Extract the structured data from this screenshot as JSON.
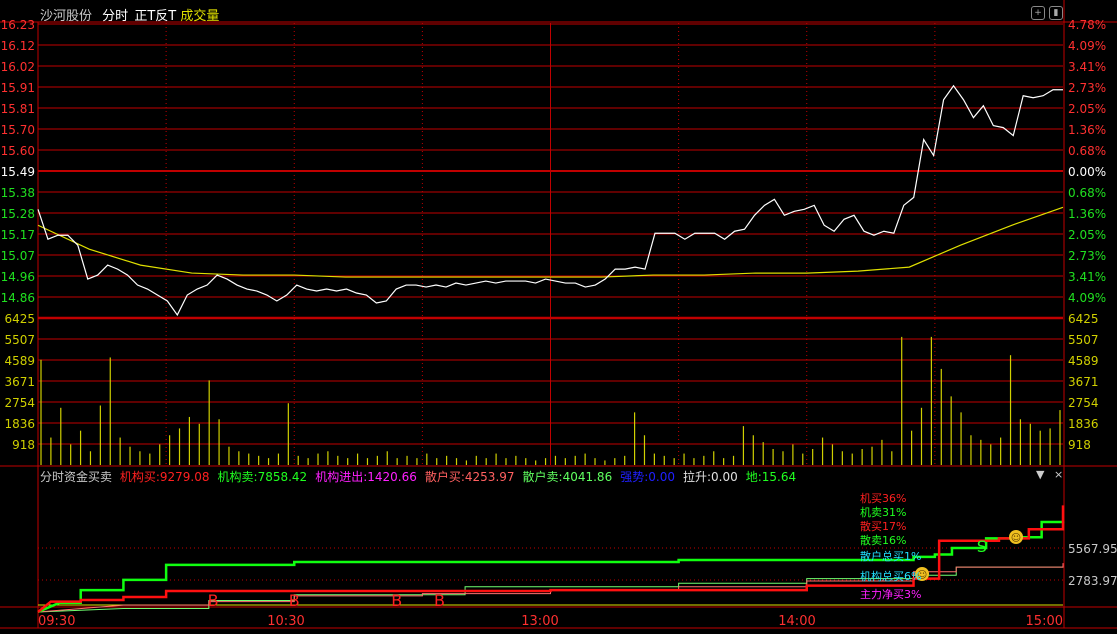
{
  "header": {
    "stock_name": "沙河股份",
    "mode": "分时",
    "strategy": "正T反T",
    "volume_label": "成交量"
  },
  "indicator": {
    "title": "分时资金买卖",
    "items": [
      {
        "label": "机构买:",
        "value": "9279.08",
        "color": "#ff2020"
      },
      {
        "label": "机构卖:",
        "value": "7858.42",
        "color": "#20ff20"
      },
      {
        "label": "机构进出:",
        "value": "1420.66",
        "color": "#ff20ff"
      },
      {
        "label": "散户买:",
        "value": "4253.97",
        "color": "#ff6060"
      },
      {
        "label": "散户卖:",
        "value": "4041.86",
        "color": "#60ff60"
      },
      {
        "label": "强势:",
        "value": "0.00",
        "color": "#2020ff"
      },
      {
        "label": "拉升:",
        "value": "0.00",
        "color": "#e0e0e0"
      },
      {
        "label": "地:",
        "value": "15.64",
        "color": "#20ff20"
      }
    ],
    "legend": [
      {
        "text": "机买36%",
        "color": "#ff2020"
      },
      {
        "text": "机卖31%",
        "color": "#20ff20"
      },
      {
        "text": "散买17%",
        "color": "#ff2020"
      },
      {
        "text": "散卖16%",
        "color": "#20ff20"
      },
      {
        "text": "散户总买1%",
        "color": "#20e0ff"
      },
      {
        "text": "机构总买6%",
        "color": "#20e0ff"
      },
      {
        "text": "主力净买3%",
        "color": "#ff20ff"
      }
    ],
    "axis_ticks": [
      "5567.95",
      "2783.97"
    ],
    "markers": [
      {
        "type": "B",
        "minute": 41
      },
      {
        "type": "B",
        "minute": 60
      },
      {
        "type": "B",
        "minute": 84
      },
      {
        "type": "B",
        "minute": 94
      },
      {
        "type": "S",
        "minute": 221
      },
      {
        "type": "smiley",
        "minute": 207
      },
      {
        "type": "smiley",
        "minute": 229
      }
    ],
    "controls": {
      "dropdown": "▼",
      "close": "×"
    }
  },
  "chart_data": {
    "type": "line",
    "title": "沙河股份 分时",
    "prev_close": 15.49,
    "price_ticks": [
      "16.23",
      "16.12",
      "16.02",
      "15.91",
      "15.81",
      "15.70",
      "15.60",
      "15.49",
      "15.38",
      "15.28",
      "15.17",
      "15.07",
      "14.96",
      "14.86"
    ],
    "pct_ticks": [
      "4.78%",
      "4.09%",
      "3.41%",
      "2.73%",
      "2.05%",
      "1.36%",
      "0.68%",
      "0.00%",
      "0.68%",
      "1.36%",
      "2.05%",
      "2.73%",
      "3.41%",
      "4.09%"
    ],
    "volume_ticks": [
      "6425",
      "5507",
      "4589",
      "3671",
      "2754",
      "1836",
      "918"
    ],
    "time_labels": [
      "09:30",
      "10:30",
      "13:00",
      "14:00",
      "15:00"
    ],
    "ylim": [
      14.86,
      16.23
    ],
    "volume_max": 6425,
    "price": [
      15.3,
      15.15,
      15.17,
      15.17,
      15.12,
      14.95,
      14.97,
      15.02,
      15.0,
      14.97,
      14.92,
      14.9,
      14.87,
      14.84,
      14.77,
      14.87,
      14.9,
      14.92,
      14.97,
      14.95,
      14.92,
      14.9,
      14.89,
      14.87,
      14.84,
      14.87,
      14.92,
      14.9,
      14.89,
      14.9,
      14.89,
      14.9,
      14.88,
      14.87,
      14.83,
      14.84,
      14.9,
      14.92,
      14.92,
      14.91,
      14.92,
      14.91,
      14.93,
      14.92,
      14.93,
      14.94,
      14.93,
      14.94,
      14.94,
      14.94,
      14.93,
      14.95,
      14.94,
      14.93,
      14.93,
      14.91,
      14.92,
      14.95,
      15.0,
      15.0,
      15.01,
      15.0,
      15.18,
      15.18,
      15.18,
      15.15,
      15.18,
      15.18,
      15.18,
      15.15,
      15.19,
      15.2,
      15.27,
      15.32,
      15.35,
      15.27,
      15.29,
      15.3,
      15.32,
      15.22,
      15.19,
      15.25,
      15.27,
      15.19,
      15.17,
      15.19,
      15.18,
      15.32,
      15.36,
      15.65,
      15.57,
      15.85,
      15.92,
      15.85,
      15.76,
      15.82,
      15.72,
      15.71,
      15.67,
      15.87,
      15.86,
      15.87,
      15.9,
      15.9
    ],
    "avg_price": [
      15.22,
      15.1,
      15.02,
      14.98,
      14.97,
      14.97,
      14.96,
      14.96,
      14.96,
      14.96,
      14.96,
      14.96,
      14.97,
      14.97,
      14.98,
      14.98,
      14.99,
      15.01,
      15.12,
      15.22,
      15.31
    ],
    "volume": [
      4600,
      1200,
      2500,
      900,
      1500,
      600,
      2600,
      4700,
      1200,
      800,
      600,
      500,
      900,
      1300,
      1600,
      2100,
      1800,
      3700,
      2000,
      800,
      600,
      500,
      400,
      300,
      500,
      2700,
      400,
      300,
      500,
      600,
      400,
      300,
      500,
      300,
      400,
      600,
      300,
      400,
      300,
      500,
      300,
      400,
      300,
      200,
      400,
      300,
      500,
      300,
      400,
      300,
      200,
      300,
      400,
      300,
      400,
      500,
      300,
      200,
      300,
      400,
      2300,
      1300,
      500,
      400,
      300,
      500,
      300,
      400,
      600,
      300,
      400,
      1700,
      1300,
      1000,
      700,
      600,
      900,
      500,
      700,
      1200,
      900,
      600,
      500,
      700,
      800,
      1100,
      600,
      5600,
      1500,
      2500,
      5600,
      4200,
      3000,
      2300,
      1300,
      1100,
      900,
      1200,
      4800,
      2000,
      1800,
      1500,
      1600,
      2400
    ],
    "series": [
      {
        "name": "机构买",
        "color": "#ff1010",
        "width": 2.5,
        "points": [
          [
            0,
            0
          ],
          [
            3,
            900
          ],
          [
            10,
            1040
          ],
          [
            20,
            1300
          ],
          [
            30,
            1830
          ],
          [
            60,
            1830
          ],
          [
            120,
            1900
          ],
          [
            180,
            2300
          ],
          [
            205,
            2900
          ],
          [
            211,
            6200
          ],
          [
            225,
            6400
          ],
          [
            232,
            7200
          ],
          [
            240,
            9279
          ]
        ]
      },
      {
        "name": "机构卖",
        "color": "#10ff10",
        "width": 2.5,
        "points": [
          [
            0,
            0
          ],
          [
            5,
            800
          ],
          [
            10,
            1900
          ],
          [
            20,
            2800
          ],
          [
            30,
            4100
          ],
          [
            60,
            4350
          ],
          [
            150,
            4520
          ],
          [
            205,
            4800
          ],
          [
            210,
            5000
          ],
          [
            214,
            5570
          ],
          [
            222,
            6400
          ],
          [
            230,
            6500
          ],
          [
            235,
            7830
          ],
          [
            240,
            7858
          ]
        ]
      },
      {
        "name": "散户买",
        "color": "#ff7070",
        "width": 1,
        "points": [
          [
            0,
            0
          ],
          [
            20,
            600
          ],
          [
            40,
            900
          ],
          [
            60,
            1400
          ],
          [
            90,
            1600
          ],
          [
            120,
            1900
          ],
          [
            150,
            2200
          ],
          [
            180,
            2700
          ],
          [
            205,
            3500
          ],
          [
            215,
            3900
          ],
          [
            240,
            4253
          ]
        ]
      },
      {
        "name": "散户卖",
        "color": "#70ff70",
        "width": 1,
        "points": [
          [
            0,
            0
          ],
          [
            20,
            300
          ],
          [
            40,
            1000
          ],
          [
            60,
            1500
          ],
          [
            100,
            2200
          ],
          [
            150,
            2500
          ],
          [
            180,
            2900
          ],
          [
            205,
            3200
          ],
          [
            215,
            3900
          ],
          [
            240,
            4041
          ]
        ]
      }
    ]
  }
}
